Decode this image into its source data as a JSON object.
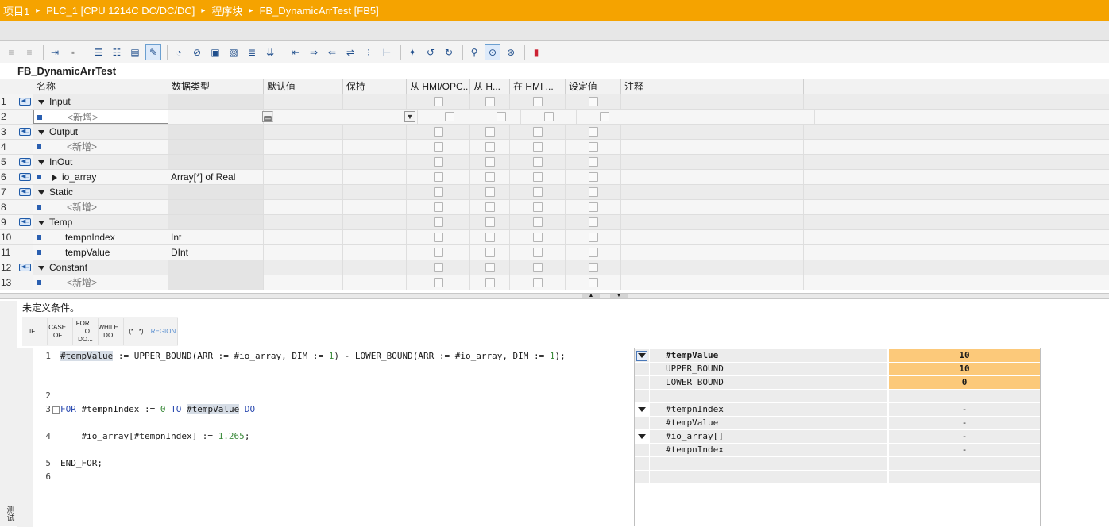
{
  "breadcrumb": [
    "项目1",
    "PLC_1 [CPU 1214C DC/DC/DC]",
    "程序块",
    "FB_DynamicArrTest [FB5]"
  ],
  "block_name": "FB_DynamicArrTest",
  "columns": [
    "名称",
    "数据类型",
    "默认值",
    "保持",
    "从 HMI/OPC..",
    "从 H...",
    "在 HMI ...",
    "设定值",
    "注释"
  ],
  "rows": [
    {
      "num": "1",
      "kind": "section",
      "name": "Input",
      "type": ""
    },
    {
      "num": "2",
      "kind": "new",
      "name": "<新增>",
      "type": ""
    },
    {
      "num": "3",
      "kind": "section",
      "name": "Output",
      "type": ""
    },
    {
      "num": "4",
      "kind": "new",
      "name": "<新增>",
      "type": ""
    },
    {
      "num": "5",
      "kind": "section",
      "name": "InOut",
      "type": ""
    },
    {
      "num": "6",
      "kind": "var",
      "name": "io_array",
      "type": "Array[*] of Real"
    },
    {
      "num": "7",
      "kind": "section",
      "name": "Static",
      "type": ""
    },
    {
      "num": "8",
      "kind": "new",
      "name": "<新增>",
      "type": ""
    },
    {
      "num": "9",
      "kind": "section",
      "name": "Temp",
      "type": ""
    },
    {
      "num": "10",
      "kind": "var",
      "name": "tempnIndex",
      "type": "Int"
    },
    {
      "num": "11",
      "kind": "var",
      "name": "tempValue",
      "type": "DInt"
    },
    {
      "num": "12",
      "kind": "section",
      "name": "Constant",
      "type": ""
    },
    {
      "num": "13",
      "kind": "new",
      "name": "<新增>",
      "type": ""
    }
  ],
  "iface_tag": "◀□",
  "condition_text": "未定义条件。",
  "snippets": [
    "IF...",
    "CASE... OF...",
    "FOR... TO DO...",
    "WHILE... DO...",
    "(*...*)",
    "REGION"
  ],
  "left_strip_label": "测试",
  "code_lines": [
    {
      "n": "1",
      "text": "#tempValue := UPPER_BOUND(ARR := #io_array, DIM := 1) - LOWER_BOUND(ARR := #io_array, DIM := 1);"
    },
    {
      "n": "2",
      "text": ""
    },
    {
      "n": "3",
      "text": "FOR #tempnIndex := 0 TO #tempValue DO"
    },
    {
      "n": "4",
      "text": "    #io_array[#tempnIndex] := 1.265;"
    },
    {
      "n": "5",
      "text": "END_FOR;"
    },
    {
      "n": "6",
      "text": ""
    }
  ],
  "watch": [
    {
      "name": "#tempValue",
      "value": "10"
    },
    {
      "name": "UPPER_BOUND",
      "value": "10"
    },
    {
      "name": "LOWER_BOUND",
      "value": "0"
    },
    {
      "name": "",
      "value": ""
    },
    {
      "name": "#tempnIndex",
      "value": "-"
    },
    {
      "name": "#tempValue",
      "value": "-"
    },
    {
      "name": "#io_array[]",
      "value": "-"
    },
    {
      "name": "#tempnIndex",
      "value": "-"
    },
    {
      "name": "",
      "value": ""
    },
    {
      "name": "",
      "value": ""
    }
  ],
  "colors": {
    "title_bar": "#f5a300",
    "watch_value": "#fcc97a",
    "keyword": "#2a4ab0"
  }
}
